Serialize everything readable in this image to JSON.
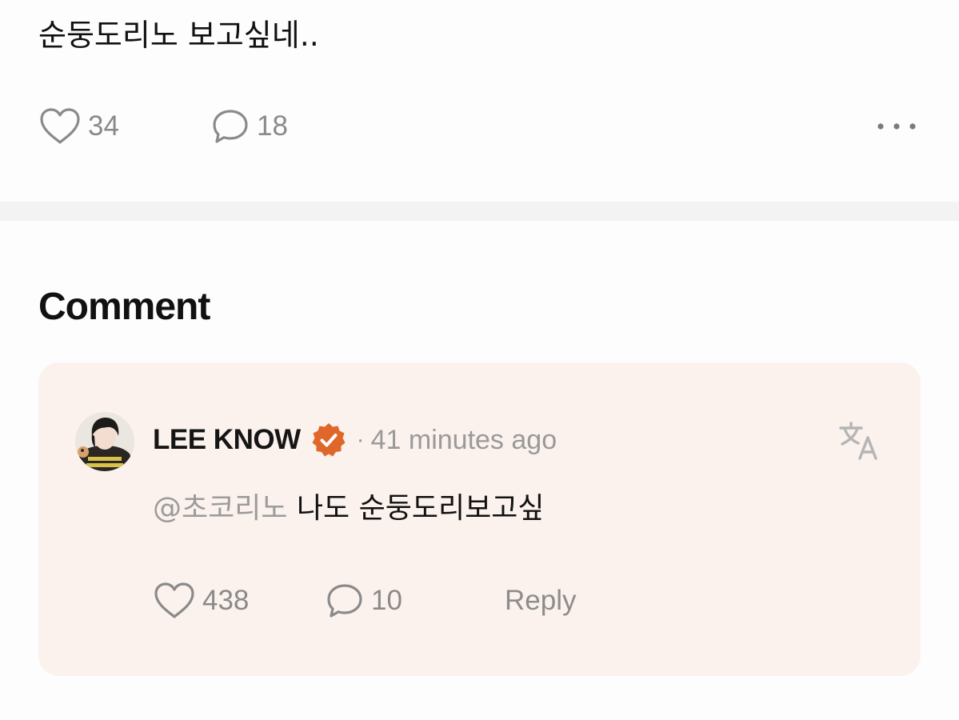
{
  "post": {
    "text": "순둥도리노 보고싶네..",
    "like_count": "34",
    "comment_count": "18"
  },
  "comments_section": {
    "title": "Comment"
  },
  "comment": {
    "author": "LEE KNOW",
    "verified": true,
    "separator": "·",
    "time": "41 minutes ago",
    "mention": "@초코리노",
    "text": "나도 순둥도리보고싶",
    "like_count": "438",
    "reply_count": "10",
    "reply_label": "Reply"
  },
  "colors": {
    "background": "#fdfdfd",
    "divider": "#f3f3f3",
    "card_background": "#fbf1ed",
    "badge_orange": "#e0672a",
    "muted_text": "#8a8a8a"
  },
  "icons": {
    "like": "heart-outline-icon",
    "comment": "speech-bubble-icon",
    "more": "more-horizontal-icon",
    "verified": "verified-badge-icon",
    "translate": "translate-icon"
  }
}
